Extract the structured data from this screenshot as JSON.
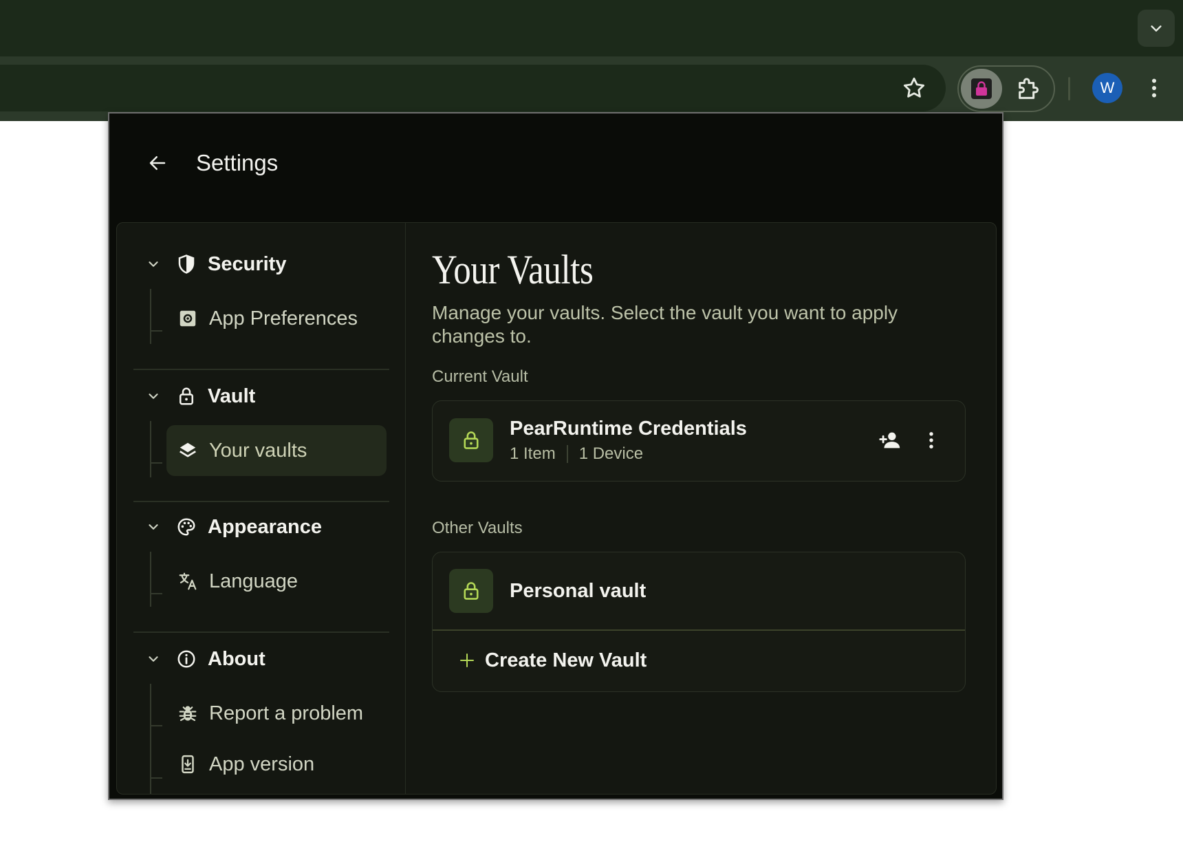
{
  "header": {
    "title": "Settings"
  },
  "sidebar": {
    "groups": [
      {
        "label": "Security",
        "icon": "shield-icon",
        "items": [
          {
            "label": "App Preferences",
            "icon": "gear-box-icon"
          }
        ]
      },
      {
        "label": "Vault",
        "icon": "lock-icon",
        "items": [
          {
            "label": "Your vaults",
            "icon": "layers-icon",
            "active": true
          }
        ]
      },
      {
        "label": "Appearance",
        "icon": "palette-icon",
        "items": [
          {
            "label": "Language",
            "icon": "translate-icon"
          }
        ]
      },
      {
        "label": "About",
        "icon": "info-icon",
        "items": [
          {
            "label": "Report a problem",
            "icon": "bug-icon"
          },
          {
            "label": "App version",
            "icon": "phone-download-icon"
          }
        ]
      }
    ]
  },
  "main": {
    "title": "Your Vaults",
    "description": "Manage your vaults. Select the vault you want to apply changes to.",
    "current_label": "Current Vault",
    "current_vault": {
      "name": "PearRuntime Credentials",
      "items": "1 Item",
      "devices": "1 Device"
    },
    "other_label": "Other Vaults",
    "other_vaults": [
      {
        "name": "Personal vault"
      }
    ],
    "create_label": "Create New Vault"
  },
  "browser": {
    "avatar_letter": "W"
  },
  "colors": {
    "accent": "#b5d957",
    "lock_bg": "#2c3a21",
    "chrome": "#1c2a1a",
    "popup_bg": "#0a0c08",
    "panel_bg": "#141711",
    "extension_icon": "#d0349a"
  }
}
